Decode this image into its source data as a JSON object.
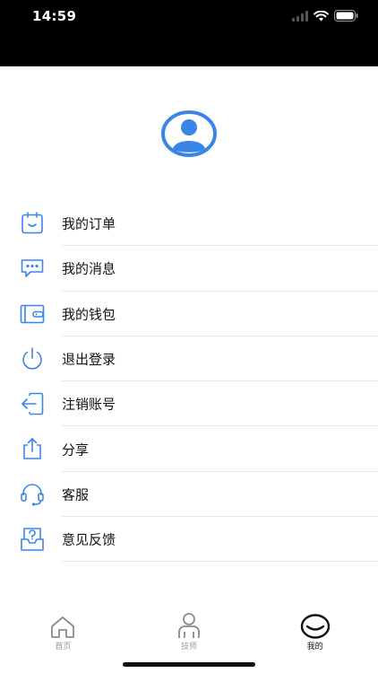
{
  "status_bar": {
    "time": "14:59",
    "icons": [
      "signal-icon",
      "wifi-icon",
      "battery-icon"
    ]
  },
  "profile": {
    "avatar_icon": "user-avatar-icon",
    "accent_color": "#3a86e8"
  },
  "menu": {
    "items": [
      {
        "label": "我的订单",
        "icon": "order-icon"
      },
      {
        "label": "我的消息",
        "icon": "message-icon"
      },
      {
        "label": "我的钱包",
        "icon": "wallet-icon"
      },
      {
        "label": "退出登录",
        "icon": "power-icon"
      },
      {
        "label": "注销账号",
        "icon": "logout-icon"
      },
      {
        "label": "分享",
        "icon": "share-icon"
      },
      {
        "label": "客服",
        "icon": "headset-icon"
      },
      {
        "label": "意见反馈",
        "icon": "feedback-icon"
      }
    ]
  },
  "tabbar": {
    "tabs": [
      {
        "label": "首页",
        "icon": "home-icon",
        "active": false
      },
      {
        "label": "技师",
        "icon": "technician-icon",
        "active": false
      },
      {
        "label": "我的",
        "icon": "mine-icon",
        "active": true
      }
    ]
  }
}
